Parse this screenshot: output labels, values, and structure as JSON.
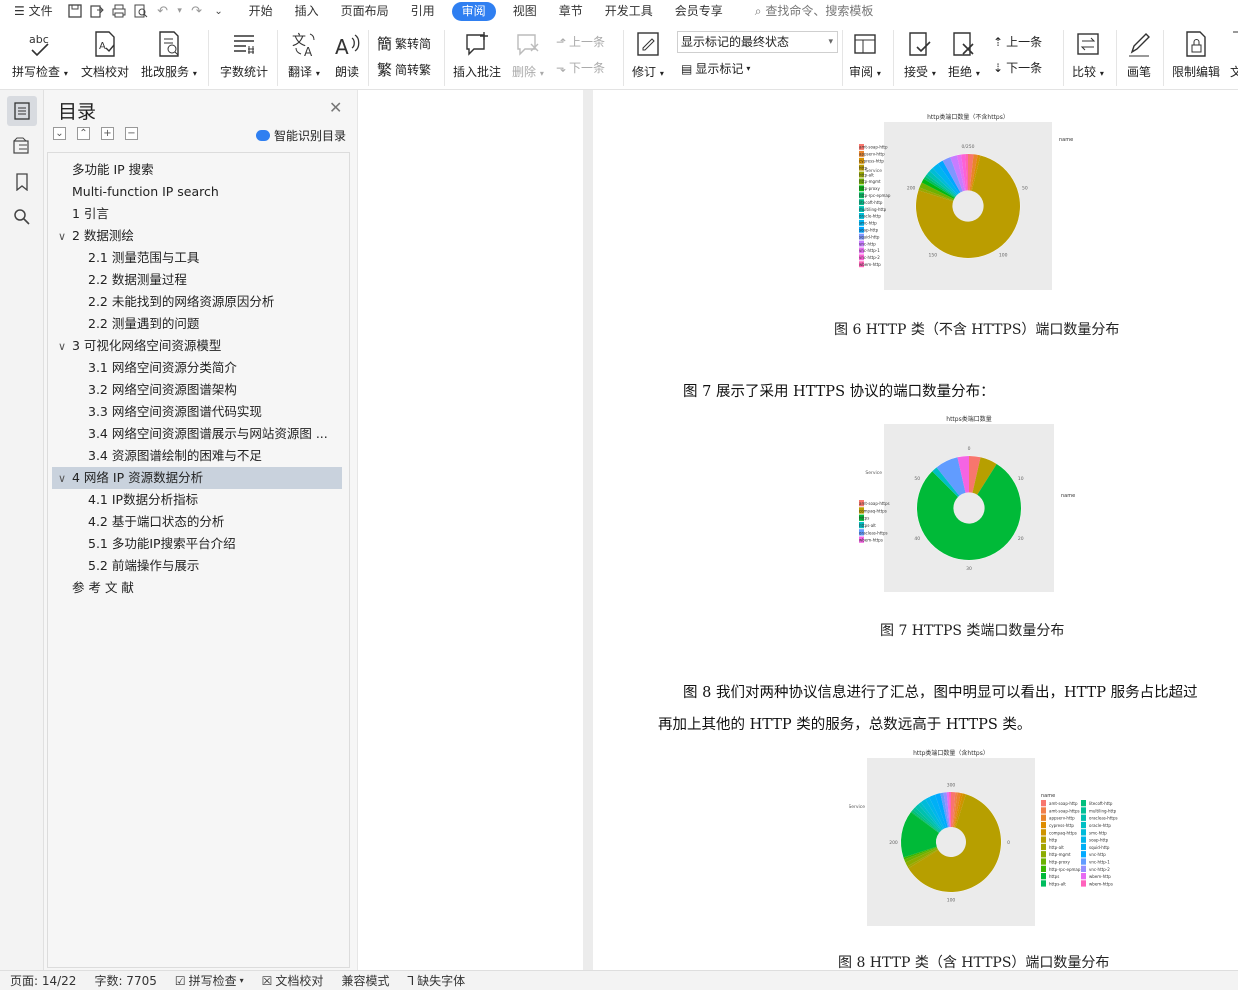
{
  "menubar": {
    "file": "文件",
    "tabs": [
      "开始",
      "插入",
      "页面布局",
      "引用",
      "审阅",
      "视图",
      "章节",
      "开发工具",
      "会员专享"
    ],
    "active_tab": "审阅",
    "search": "查找命令、搜索模板"
  },
  "ribbon": {
    "spell_check": "拼写检查",
    "doc_check": "文档校对",
    "batch_service": "批改服务",
    "word_count": "字数统计",
    "translate": "翻译",
    "read_aloud": "朗读",
    "to_traditional": "繁转简",
    "to_simplified": "简转繁",
    "insert_comment": "插入批注",
    "delete": "删除",
    "prev_comment": "上一条",
    "next_comment": "下一条",
    "track_changes": "修订",
    "display_select": "显示标记的最终状态",
    "show_markup": "显示标记",
    "review": "审阅",
    "accept": "接受",
    "reject": "拒绝",
    "prev_change": "上一条",
    "next_change": "下一条",
    "compare": "比较",
    "pen": "画笔",
    "restrict_edit": "限制编辑",
    "more": "文"
  },
  "toc": {
    "title": "目录",
    "smart": "智能识别目录",
    "items": [
      {
        "text": "多功能 IP 搜索",
        "level": 0
      },
      {
        "text": "Multi-function IP search",
        "level": 0
      },
      {
        "text": "1  引言",
        "level": 0
      },
      {
        "text": "2  数据测绘",
        "level": 0,
        "toggle": "∨"
      },
      {
        "text": "2.1    测量范围与工具",
        "level": 1
      },
      {
        "text": "2.2    数据测量过程",
        "level": 1
      },
      {
        "text": "2.2    未能找到的网络资源原因分析",
        "level": 1
      },
      {
        "text": "2.2    测量遇到的问题",
        "level": 1
      },
      {
        "text": "3  可视化网络空间资源模型",
        "level": 0,
        "toggle": "∨"
      },
      {
        "text": "3.1    网络空间资源分类简介",
        "level": 1
      },
      {
        "text": "3.2    网络空间资源图谱架构",
        "level": 1
      },
      {
        "text": "3.3    网络空间资源图谱代码实现",
        "level": 1
      },
      {
        "text": "3.4    网络空间资源图谱展示与网站资源图 ...",
        "level": 1
      },
      {
        "text": "3.4    资源图谱绘制的困难与不足",
        "level": 1
      },
      {
        "text": "4  网络 IP 资源数据分析",
        "level": 0,
        "toggle": "∨",
        "selected": true
      },
      {
        "text": "4.1    IP数据分析指标",
        "level": 1
      },
      {
        "text": "4.2    基于端口状态的分析",
        "level": 1
      },
      {
        "text": "5.1    多功能IP搜索平台介绍",
        "level": 1
      },
      {
        "text": "5.2    前端操作与展示",
        "level": 1
      },
      {
        "text": "参 考 文 献",
        "level": 0
      }
    ]
  },
  "document": {
    "fig6_caption": "图 6    HTTP 类（不含 HTTPS）端口数量分布",
    "fig7_intro": "图 7 展示了采用 HTTPS 协议的端口数量分布：",
    "fig7_caption": "图 7    HTTPS 类端口数量分布",
    "fig8_line1": "图 8 我们对两种协议信息进行了汇总，图中明显可以看出，HTTP 服务占比超过",
    "fig8_line2": "再加上其他的 HTTP 类的服务，总数远高于 HTTPS 类。",
    "fig8_caption": "图 8    HTTP 类（含 HTTPS）端口数量分布"
  },
  "chart_data": [
    {
      "type": "pie",
      "title": "http类端口数量（不含https）",
      "ylabel": "Service",
      "legend_title": "name",
      "categories": [
        "amt-soap-http",
        "appserv-http",
        "cypress-http",
        "http",
        "http-alt",
        "http-mgmt",
        "http-proxy",
        "http-rpc-epmap",
        "litecoft-http",
        "multiling-http",
        "oracle-http",
        "smc-http",
        "soap-http",
        "squid-http",
        "vnc-http",
        "vnc-http-1",
        "vnc-http-2",
        "wbem-http"
      ],
      "values": [
        4,
        3,
        2,
        178,
        2,
        4,
        3,
        2,
        2,
        3,
        3,
        5,
        4,
        6,
        5,
        3,
        3,
        2
      ],
      "colors": [
        "#f8766d",
        "#e9842c",
        "#d69100",
        "#bb9d00",
        "#99a800",
        "#6fb000",
        "#00b813",
        "#00bd61",
        "#00c08e",
        "#00c0b3",
        "#00bcd6",
        "#00b4ef",
        "#00a6ff",
        "#7f96ff",
        "#c77cff",
        "#e86ff2",
        "#fc61d7",
        "#ff63b6"
      ],
      "ticks": [
        "0/250",
        "50",
        "100",
        "150",
        "200"
      ],
      "legend_placement": "right"
    },
    {
      "type": "pie",
      "title": "https类端口数量",
      "ylabel": "Service",
      "legend_title": "name",
      "categories": [
        "amt-soap-https",
        "compaq-https",
        "https",
        "https-alt",
        "oracleas-https",
        "wbem-https"
      ],
      "values": [
        2,
        3,
        44,
        1,
        4,
        2
      ],
      "colors": [
        "#f8766d",
        "#b79f00",
        "#00ba38",
        "#00bfc4",
        "#619cff",
        "#f564e3"
      ],
      "ticks": [
        "0",
        "10",
        "20",
        "30",
        "40",
        "50"
      ],
      "legend_placement": "right"
    },
    {
      "type": "pie",
      "title": "http类端口数量（含https）",
      "ylabel": "Service",
      "legend_title": "name",
      "categories": [
        "amt-soap-http",
        "amt-soap-https",
        "appserv-http",
        "cypress-http",
        "compaq-https",
        "http",
        "http-alt",
        "http-mgmt",
        "http-proxy",
        "http-rpc-epmap",
        "https",
        "https-alt",
        "litecoft-http",
        "multiling-http",
        "oracleas-https",
        "oracle-http",
        "smc-http",
        "soap-http",
        "squid-http",
        "vnc-http",
        "vnc-http-1",
        "vnc-http-2",
        "wbem-http",
        "wbem-https"
      ],
      "values": [
        4,
        2,
        3,
        2,
        3,
        178,
        2,
        4,
        3,
        2,
        44,
        1,
        2,
        3,
        4,
        3,
        5,
        4,
        6,
        5,
        3,
        3,
        2,
        2
      ],
      "colors": [
        "#f8766d",
        "#f17e4a",
        "#e9842c",
        "#de8c00",
        "#cf9400",
        "#b79f00",
        "#a3a500",
        "#8bac00",
        "#6bb100",
        "#39b600",
        "#00ba38",
        "#00bd5f",
        "#00bf7d",
        "#00c097",
        "#00c0af",
        "#00bfc4",
        "#00bbda",
        "#00b6eb",
        "#00b0f6",
        "#00a9ff",
        "#619cff",
        "#9590ff",
        "#e76bf3",
        "#ff62bc"
      ],
      "ticks": [
        "300",
        "0",
        "100",
        "200"
      ],
      "legend_placement": "right"
    }
  ],
  "status": {
    "page": "页面: 14/22",
    "words": "字数: 7705",
    "spell": "拼写检查",
    "proof": "文档校对",
    "compat": "兼容模式",
    "missing_font": "缺失字体"
  }
}
